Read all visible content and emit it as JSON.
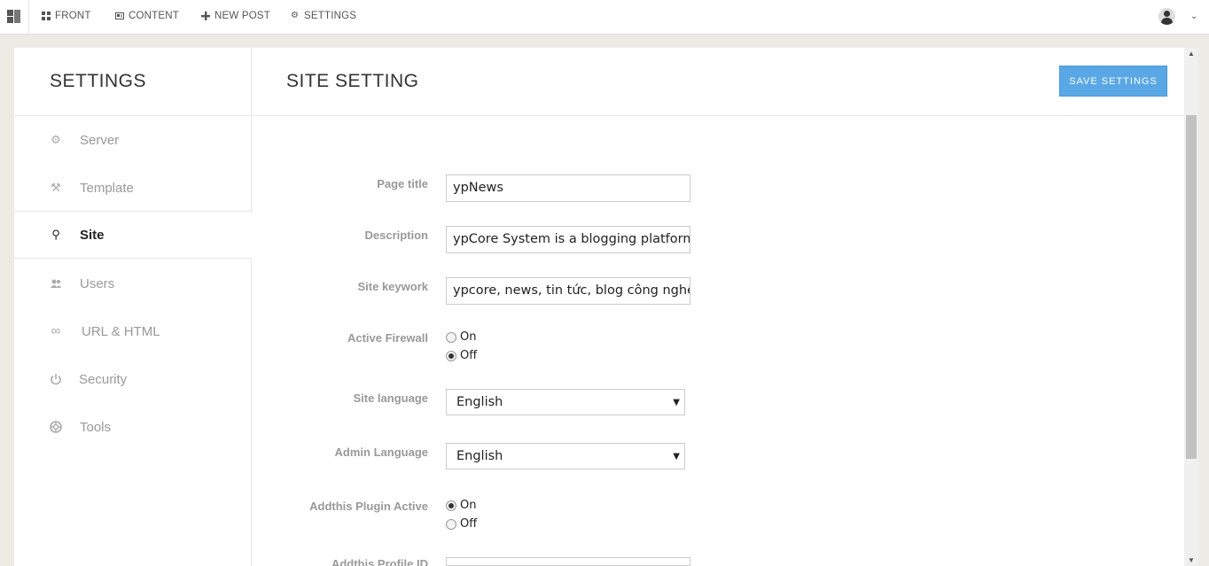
{
  "topnav": {
    "items": [
      {
        "label": "FRONT",
        "icon": "grid-icon"
      },
      {
        "label": "CONTENT",
        "icon": "document-icon"
      },
      {
        "label": "NEW POST",
        "icon": "plus-icon"
      },
      {
        "label": "SETTINGS",
        "icon": "gear-icon"
      }
    ],
    "user_menu_caret": "⌄"
  },
  "sidebar": {
    "title": "SETTINGS",
    "items": [
      {
        "label": "Server",
        "icon": "gears-icon",
        "glyph": "⚙"
      },
      {
        "label": "Template",
        "icon": "brush-icon",
        "glyph": "⚒"
      },
      {
        "label": "Site",
        "icon": "site-icon",
        "glyph": "⚲"
      },
      {
        "label": "Users",
        "icon": "users-icon",
        "glyph": "👥"
      },
      {
        "label": "URL & HTML",
        "icon": "link-icon",
        "glyph": "∞"
      },
      {
        "label": "Security",
        "icon": "power-icon",
        "glyph": "⏻"
      },
      {
        "label": "Tools",
        "icon": "lifebuoy-icon",
        "glyph": "⊕"
      }
    ],
    "active": "Site"
  },
  "main": {
    "title": "SITE SETTING",
    "save_label": "SAVE SETTINGS",
    "fields": {
      "page_title": {
        "label": "Page title",
        "value": "ypNews"
      },
      "description": {
        "label": "Description",
        "value": "ypCore System is a blogging platform. B"
      },
      "site_keyword": {
        "label": "Site keywork",
        "value": "ypcore, news, tin tức, blog công nghệ"
      },
      "active_firewall": {
        "label": "Active Firewall",
        "options": [
          "On",
          "Off"
        ],
        "selected": "Off"
      },
      "site_language": {
        "label": "Site language",
        "value": "English"
      },
      "admin_language": {
        "label": "Admin Language",
        "value": "English"
      },
      "addthis_active": {
        "label": "Addthis Plugin Active",
        "options": [
          "On",
          "Off"
        ],
        "selected": "On"
      },
      "addthis_profile": {
        "label": "Addthis Profile ID",
        "value": ""
      }
    }
  },
  "colors": {
    "accent": "#5aa7e6",
    "background": "#ecebe6",
    "muted_text": "#999999"
  }
}
